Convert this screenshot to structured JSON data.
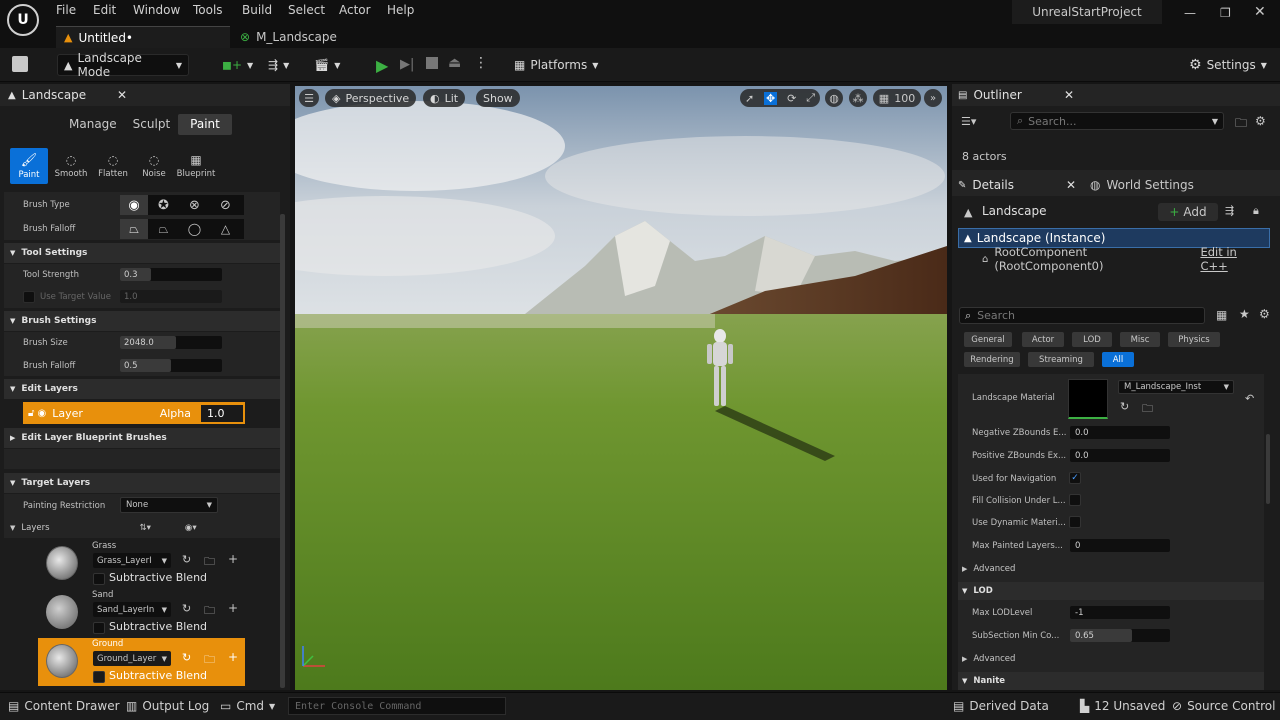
{
  "menu": [
    "File",
    "Edit",
    "Window",
    "Tools",
    "Build",
    "Select",
    "Actor",
    "Help"
  ],
  "project_name": "UnrealStartProject",
  "doc_tabs": [
    {
      "label": "Untitled•"
    },
    {
      "label": "M_Landscape"
    }
  ],
  "toolbar": {
    "mode": "Landscape Mode",
    "platforms": "Platforms",
    "settings": "Settings"
  },
  "landscape_panel": {
    "title": "Landscape",
    "modes": [
      "Manage",
      "Sculpt",
      "Paint"
    ],
    "active_mode": "Paint",
    "tools": [
      "Paint",
      "Smooth",
      "Flatten",
      "Noise",
      "Blueprint"
    ],
    "brush_type_label": "Brush Type",
    "brush_falloff_label": "Brush Falloff",
    "tool_settings": "Tool Settings",
    "tool_strength_label": "Tool Strength",
    "tool_strength": "0.3",
    "use_target_value_label": "Use Target Value",
    "target_value": "1.0",
    "brush_settings": "Brush Settings",
    "brush_size_label": "Brush Size",
    "brush_size": "2048.0",
    "brush_falloff2_label": "Brush Falloff",
    "brush_falloff_value": "0.5",
    "edit_layers": "Edit Layers",
    "layer_name": "Layer",
    "alpha_label": "Alpha",
    "alpha_value": "1.0",
    "edit_layer_bp": "Edit Layer Blueprint Brushes",
    "target_layers": "Target Layers",
    "painting_restriction_label": "Painting Restriction",
    "painting_restriction": "None",
    "layers_label": "Layers",
    "layers": [
      {
        "name": "Grass",
        "info": "Grass_LayerI",
        "blend": "Subtractive Blend"
      },
      {
        "name": "Sand",
        "info": "Sand_LayerIn",
        "blend": "Subtractive Blend"
      },
      {
        "name": "Ground",
        "info": "Ground_Layer",
        "blend": "Subtractive Blend"
      }
    ]
  },
  "viewport": {
    "perspective": "Perspective",
    "lit": "Lit",
    "show": "Show",
    "grid": "100"
  },
  "outliner": {
    "title": "Outliner",
    "search_placeholder": "Search...",
    "count": "8 actors"
  },
  "details": {
    "tab": "Details",
    "world_settings": "World Settings",
    "actor": "Landscape",
    "add": "Add",
    "instance": "Landscape (Instance)",
    "root": "RootComponent (RootComponent0)",
    "edit_cpp": "Edit in C++",
    "search_placeholder": "Search",
    "categories": [
      "General",
      "Actor",
      "LOD",
      "Misc",
      "Physics",
      "Rendering",
      "Streaming",
      "All"
    ],
    "landscape_material_label": "Landscape Material",
    "landscape_material": "M_Landscape_Inst",
    "neg_z_label": "Negative ZBounds E...",
    "neg_z": "0.0",
    "pos_z_label": "Positive ZBounds Ex...",
    "pos_z": "0.0",
    "nav_label": "Used for Navigation",
    "fill_label": "Fill Collision Under L...",
    "dyn_label": "Use Dynamic Materi...",
    "max_painted_label": "Max Painted Layers...",
    "max_painted": "0",
    "advanced": "Advanced",
    "lod_section": "LOD",
    "max_lod_label": "Max LODLevel",
    "max_lod": "-1",
    "subsection_label": "SubSection Min Co...",
    "subsection": "0.65",
    "advanced2": "Advanced",
    "nanite": "Nanite"
  },
  "statusbar": {
    "content_drawer": "Content Drawer",
    "output_log": "Output Log",
    "cmd": "Cmd",
    "console_placeholder": "Enter Console Command",
    "derived_data": "Derived Data",
    "unsaved": "12 Unsaved",
    "source_control": "Source Control"
  },
  "colors": {
    "accent_orange": "#e8900c",
    "accent_blue": "#0a70d8",
    "play_green": "#3cb043"
  }
}
